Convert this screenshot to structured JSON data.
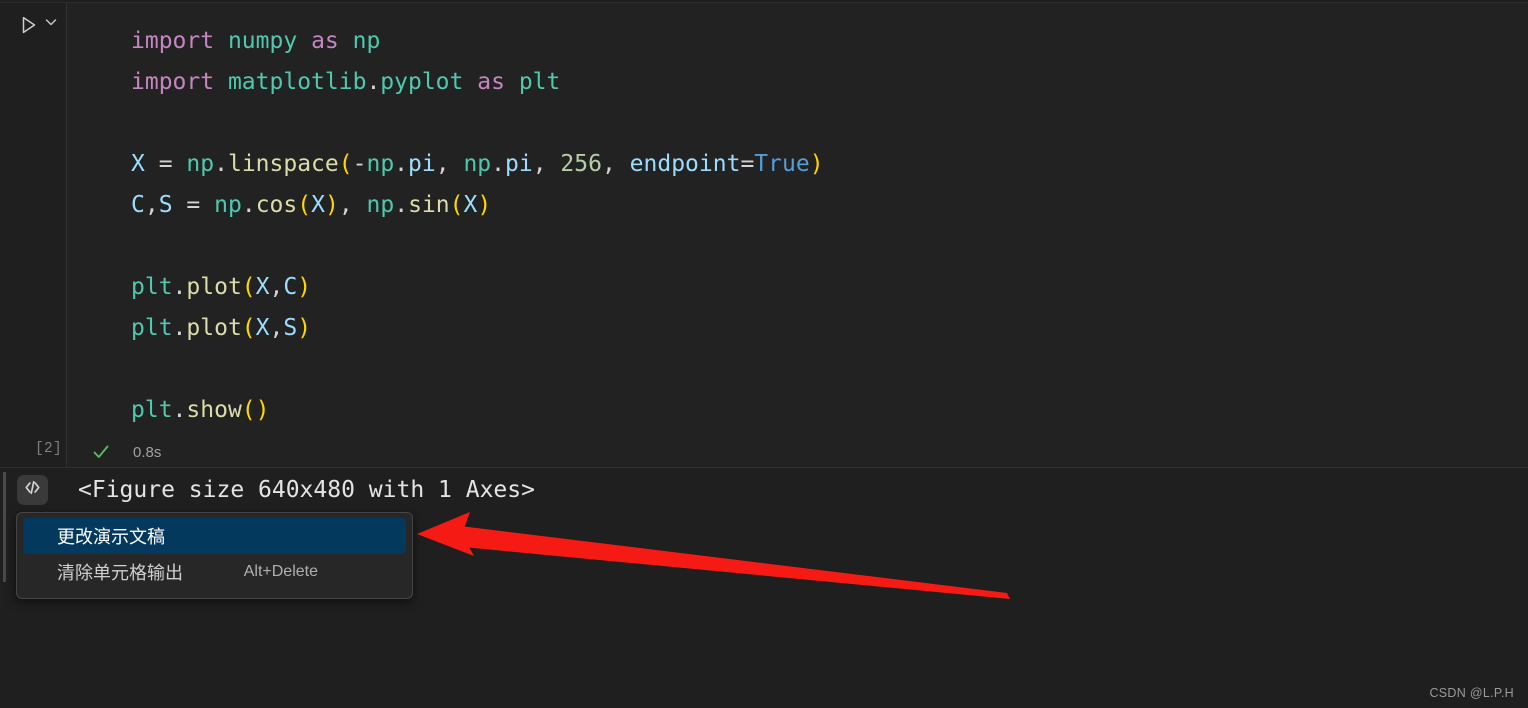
{
  "editor": {
    "run_button_icon": "play-triangle-icon",
    "run_chevron_icon": "chevron-down-icon",
    "execution_count": "[2]",
    "status_icon": "check-mark-icon",
    "execution_time": "0.8s",
    "code_lines": [
      [
        {
          "t": "import",
          "c": "kw"
        },
        {
          "t": " ",
          "c": "op"
        },
        {
          "t": "numpy",
          "c": "mod"
        },
        {
          "t": " ",
          "c": "op"
        },
        {
          "t": "as",
          "c": "kw"
        },
        {
          "t": " ",
          "c": "op"
        },
        {
          "t": "np",
          "c": "mod"
        }
      ],
      [
        {
          "t": "import",
          "c": "kw"
        },
        {
          "t": " ",
          "c": "op"
        },
        {
          "t": "matplotlib",
          "c": "mod"
        },
        {
          "t": ".",
          "c": "op"
        },
        {
          "t": "pyplot",
          "c": "mod"
        },
        {
          "t": " ",
          "c": "op"
        },
        {
          "t": "as",
          "c": "kw"
        },
        {
          "t": " ",
          "c": "op"
        },
        {
          "t": "plt",
          "c": "mod"
        }
      ],
      [],
      [
        {
          "t": "X",
          "c": "var"
        },
        {
          "t": " = ",
          "c": "op"
        },
        {
          "t": "np",
          "c": "mod"
        },
        {
          "t": ".",
          "c": "op"
        },
        {
          "t": "linspace",
          "c": "fn"
        },
        {
          "t": "(",
          "c": "paren"
        },
        {
          "t": "-",
          "c": "op"
        },
        {
          "t": "np",
          "c": "mod"
        },
        {
          "t": ".",
          "c": "op"
        },
        {
          "t": "pi",
          "c": "var"
        },
        {
          "t": ", ",
          "c": "op"
        },
        {
          "t": "np",
          "c": "mod"
        },
        {
          "t": ".",
          "c": "op"
        },
        {
          "t": "pi",
          "c": "var"
        },
        {
          "t": ", ",
          "c": "op"
        },
        {
          "t": "256",
          "c": "num"
        },
        {
          "t": ", ",
          "c": "op"
        },
        {
          "t": "endpoint",
          "c": "var"
        },
        {
          "t": "=",
          "c": "op"
        },
        {
          "t": "True",
          "c": "const"
        },
        {
          "t": ")",
          "c": "paren"
        }
      ],
      [
        {
          "t": "C",
          "c": "var"
        },
        {
          "t": ",",
          "c": "op"
        },
        {
          "t": "S",
          "c": "var"
        },
        {
          "t": " = ",
          "c": "op"
        },
        {
          "t": "np",
          "c": "mod"
        },
        {
          "t": ".",
          "c": "op"
        },
        {
          "t": "cos",
          "c": "fn"
        },
        {
          "t": "(",
          "c": "paren"
        },
        {
          "t": "X",
          "c": "var"
        },
        {
          "t": ")",
          "c": "paren"
        },
        {
          "t": ", ",
          "c": "op"
        },
        {
          "t": "np",
          "c": "mod"
        },
        {
          "t": ".",
          "c": "op"
        },
        {
          "t": "sin",
          "c": "fn"
        },
        {
          "t": "(",
          "c": "paren"
        },
        {
          "t": "X",
          "c": "var"
        },
        {
          "t": ")",
          "c": "paren"
        }
      ],
      [],
      [
        {
          "t": "plt",
          "c": "mod"
        },
        {
          "t": ".",
          "c": "op"
        },
        {
          "t": "plot",
          "c": "fn"
        },
        {
          "t": "(",
          "c": "paren"
        },
        {
          "t": "X",
          "c": "var"
        },
        {
          "t": ",",
          "c": "op"
        },
        {
          "t": "C",
          "c": "var"
        },
        {
          "t": ")",
          "c": "paren"
        }
      ],
      [
        {
          "t": "plt",
          "c": "mod"
        },
        {
          "t": ".",
          "c": "op"
        },
        {
          "t": "plot",
          "c": "fn"
        },
        {
          "t": "(",
          "c": "paren"
        },
        {
          "t": "X",
          "c": "var"
        },
        {
          "t": ",",
          "c": "op"
        },
        {
          "t": "S",
          "c": "var"
        },
        {
          "t": ")",
          "c": "paren"
        }
      ],
      [],
      [
        {
          "t": "plt",
          "c": "mod"
        },
        {
          "t": ".",
          "c": "op"
        },
        {
          "t": "show",
          "c": "fn"
        },
        {
          "t": "(",
          "c": "paren"
        },
        {
          "t": ")",
          "c": "paren"
        }
      ]
    ]
  },
  "output": {
    "badge_icon": "code-brackets-icon",
    "text": "<Figure size 640x480 with 1 Axes>"
  },
  "context_menu": {
    "items": [
      {
        "label": "更改演示文稿",
        "shortcut": "",
        "selected": true
      },
      {
        "label": "清除单元格输出",
        "shortcut": "Alt+Delete",
        "selected": false
      }
    ]
  },
  "annotation": {
    "arrow_color": "#f51b14",
    "arrow_name": "red-pointer-arrow"
  },
  "watermark": {
    "text": "CSDN @L.P.H"
  },
  "colors": {
    "background": "#1f1f1f",
    "editor_background": "#222222",
    "menu_background": "#272727",
    "menu_selected": "#04395e",
    "keyword": "#c586c0",
    "module": "#4ec9b0",
    "function": "#dcdcaa",
    "paren": "#ffd700",
    "variable": "#9cdcfe",
    "number": "#b5cea8",
    "constant": "#569cd6",
    "status_ok": "#55c05a"
  }
}
